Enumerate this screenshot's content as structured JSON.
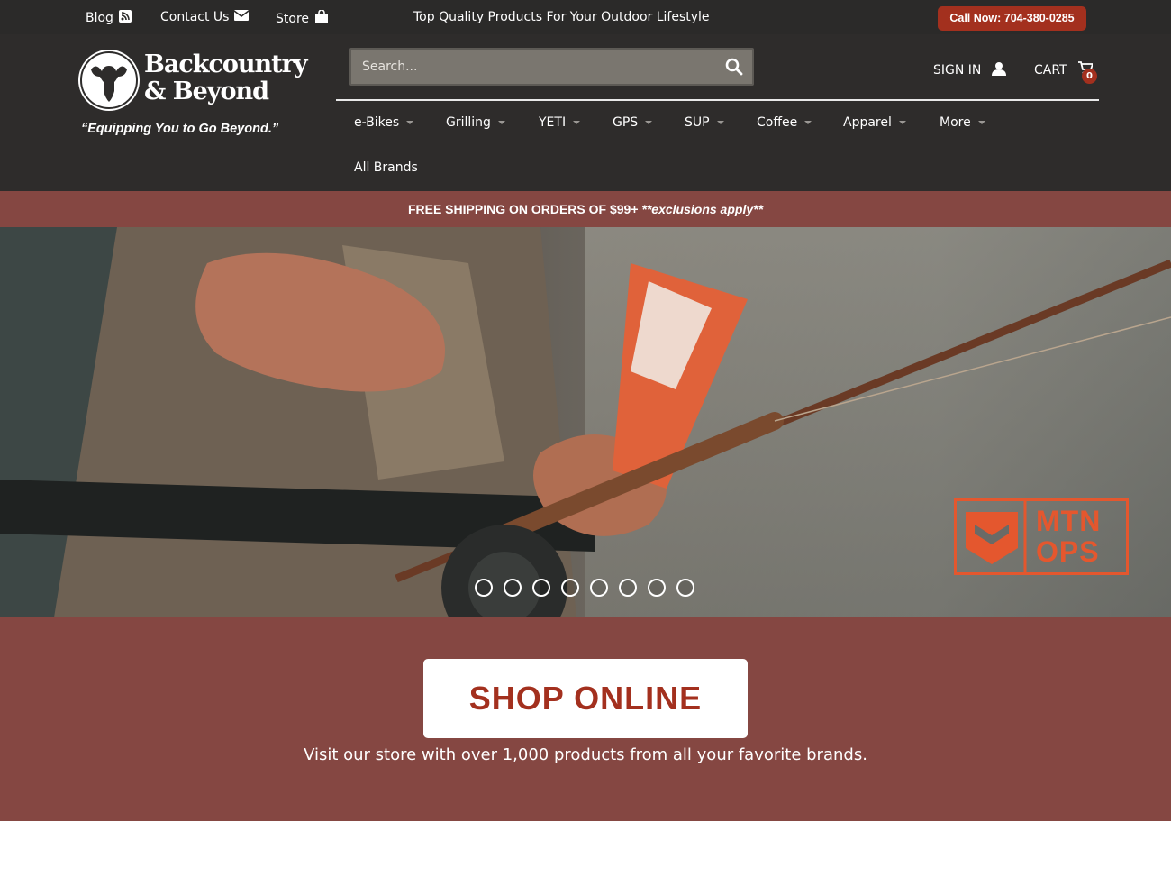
{
  "topbar": {
    "blog_label": "Blog",
    "contact_label": "Contact Us",
    "store_label": "Store",
    "tagline": "Top Quality Products For Your Outdoor Lifestyle",
    "call_label": "Call Now: 704-380-0285"
  },
  "header": {
    "logo_line1": "Backcountry",
    "logo_line2": "& Beyond",
    "slogan": "“Equipping You to Go Beyond.”",
    "search_placeholder": "Search...",
    "sign_in_label": "SIGN IN",
    "cart_label": "CART",
    "cart_count": "0"
  },
  "nav": {
    "items": [
      "e-Bikes",
      "Grilling",
      "YETI",
      "GPS",
      "SUP",
      "Coffee",
      "Apparel",
      "More"
    ],
    "all_brands": "All Brands"
  },
  "shipping": {
    "main": "FREE SHIPPING ON ORDERS OF $99+ ",
    "note": "**exclusions apply**"
  },
  "hero": {
    "brand_logo_text_1": "MTN",
    "brand_logo_text_2": "OPS",
    "slide_count": 8,
    "active_slide": 0
  },
  "shop": {
    "button_label": "SHOP ONLINE",
    "subtitle": "Visit our store with over 1,000 products from all your favorite brands."
  },
  "colors": {
    "dark": "#2e2c2b",
    "accent_red": "#a3301e",
    "band": "#854742",
    "mtn_orange": "#e4572e"
  }
}
